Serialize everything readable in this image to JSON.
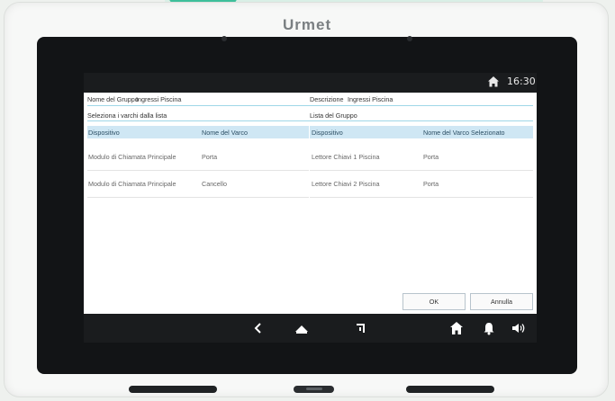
{
  "device": {
    "brand": "Urmet"
  },
  "statusbar": {
    "time": "16:30",
    "home_icon": "home-icon"
  },
  "form": {
    "group_name_label": "Nome del Gruppo",
    "group_name_value": "Ingressi Piscina",
    "description_label": "Descrizione",
    "description_value": "Ingressi Piscina",
    "select_label": "Seleziona i varchi dalla lista",
    "group_list_label": "Lista del Gruppo"
  },
  "left_table": {
    "headers": [
      "Dispositivo",
      "Nome del Varco"
    ],
    "rows": [
      [
        "Modulo di Chiamata Principale",
        "Porta"
      ],
      [
        "Modulo di Chiamata Principale",
        "Cancello"
      ]
    ]
  },
  "right_table": {
    "headers": [
      "Dispositivo",
      "Nome del Varco Selezionato"
    ],
    "rows": [
      [
        "Lettore Chiavi 1 Piscina",
        "Porta"
      ],
      [
        "Lettore Chiavi 2 Piscina",
        "Porta"
      ]
    ]
  },
  "buttons": {
    "ok": "OK",
    "cancel": "Annulla"
  },
  "navbar": {
    "icons": [
      "back-icon",
      "home-icon",
      "recent-apps-icon",
      "house-icon",
      "bell-icon",
      "speaker-icon"
    ]
  }
}
